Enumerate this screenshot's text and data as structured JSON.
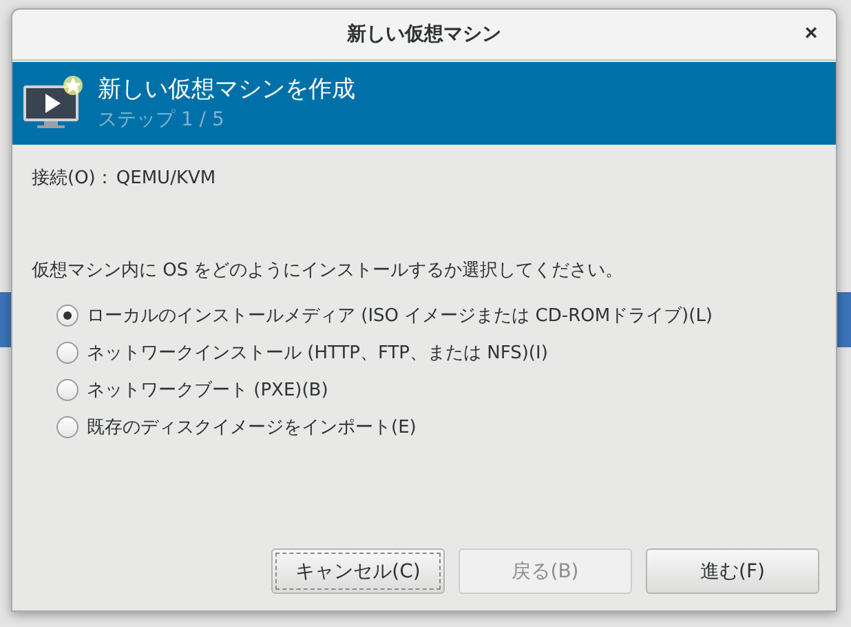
{
  "window": {
    "title": "新しい仮想マシン"
  },
  "close_button": {
    "label": "×"
  },
  "header": {
    "title": "新しい仮想マシンを作成",
    "step": "ステップ 1 / 5"
  },
  "connection": {
    "label": "接続(O)：",
    "value": "QEMU/KVM"
  },
  "question": "仮想マシン内に OS をどのようにインストールするか選択してください。",
  "options": [
    {
      "label": "ローカルのインストールメディア (ISO イメージまたは CD-ROMドライブ)(L)",
      "selected": true
    },
    {
      "label": "ネットワークインストール (HTTP、FTP、または NFS)(I)",
      "selected": false
    },
    {
      "label": "ネットワークブート (PXE)(B)",
      "selected": false
    },
    {
      "label": "既存のディスクイメージをインポート(E)",
      "selected": false
    }
  ],
  "buttons": [
    {
      "label": "キャンセル(C)",
      "disabled": false,
      "focused": true
    },
    {
      "label": "戻る(B)",
      "disabled": true,
      "focused": false
    },
    {
      "label": "進む(F)",
      "disabled": false,
      "focused": false
    }
  ]
}
